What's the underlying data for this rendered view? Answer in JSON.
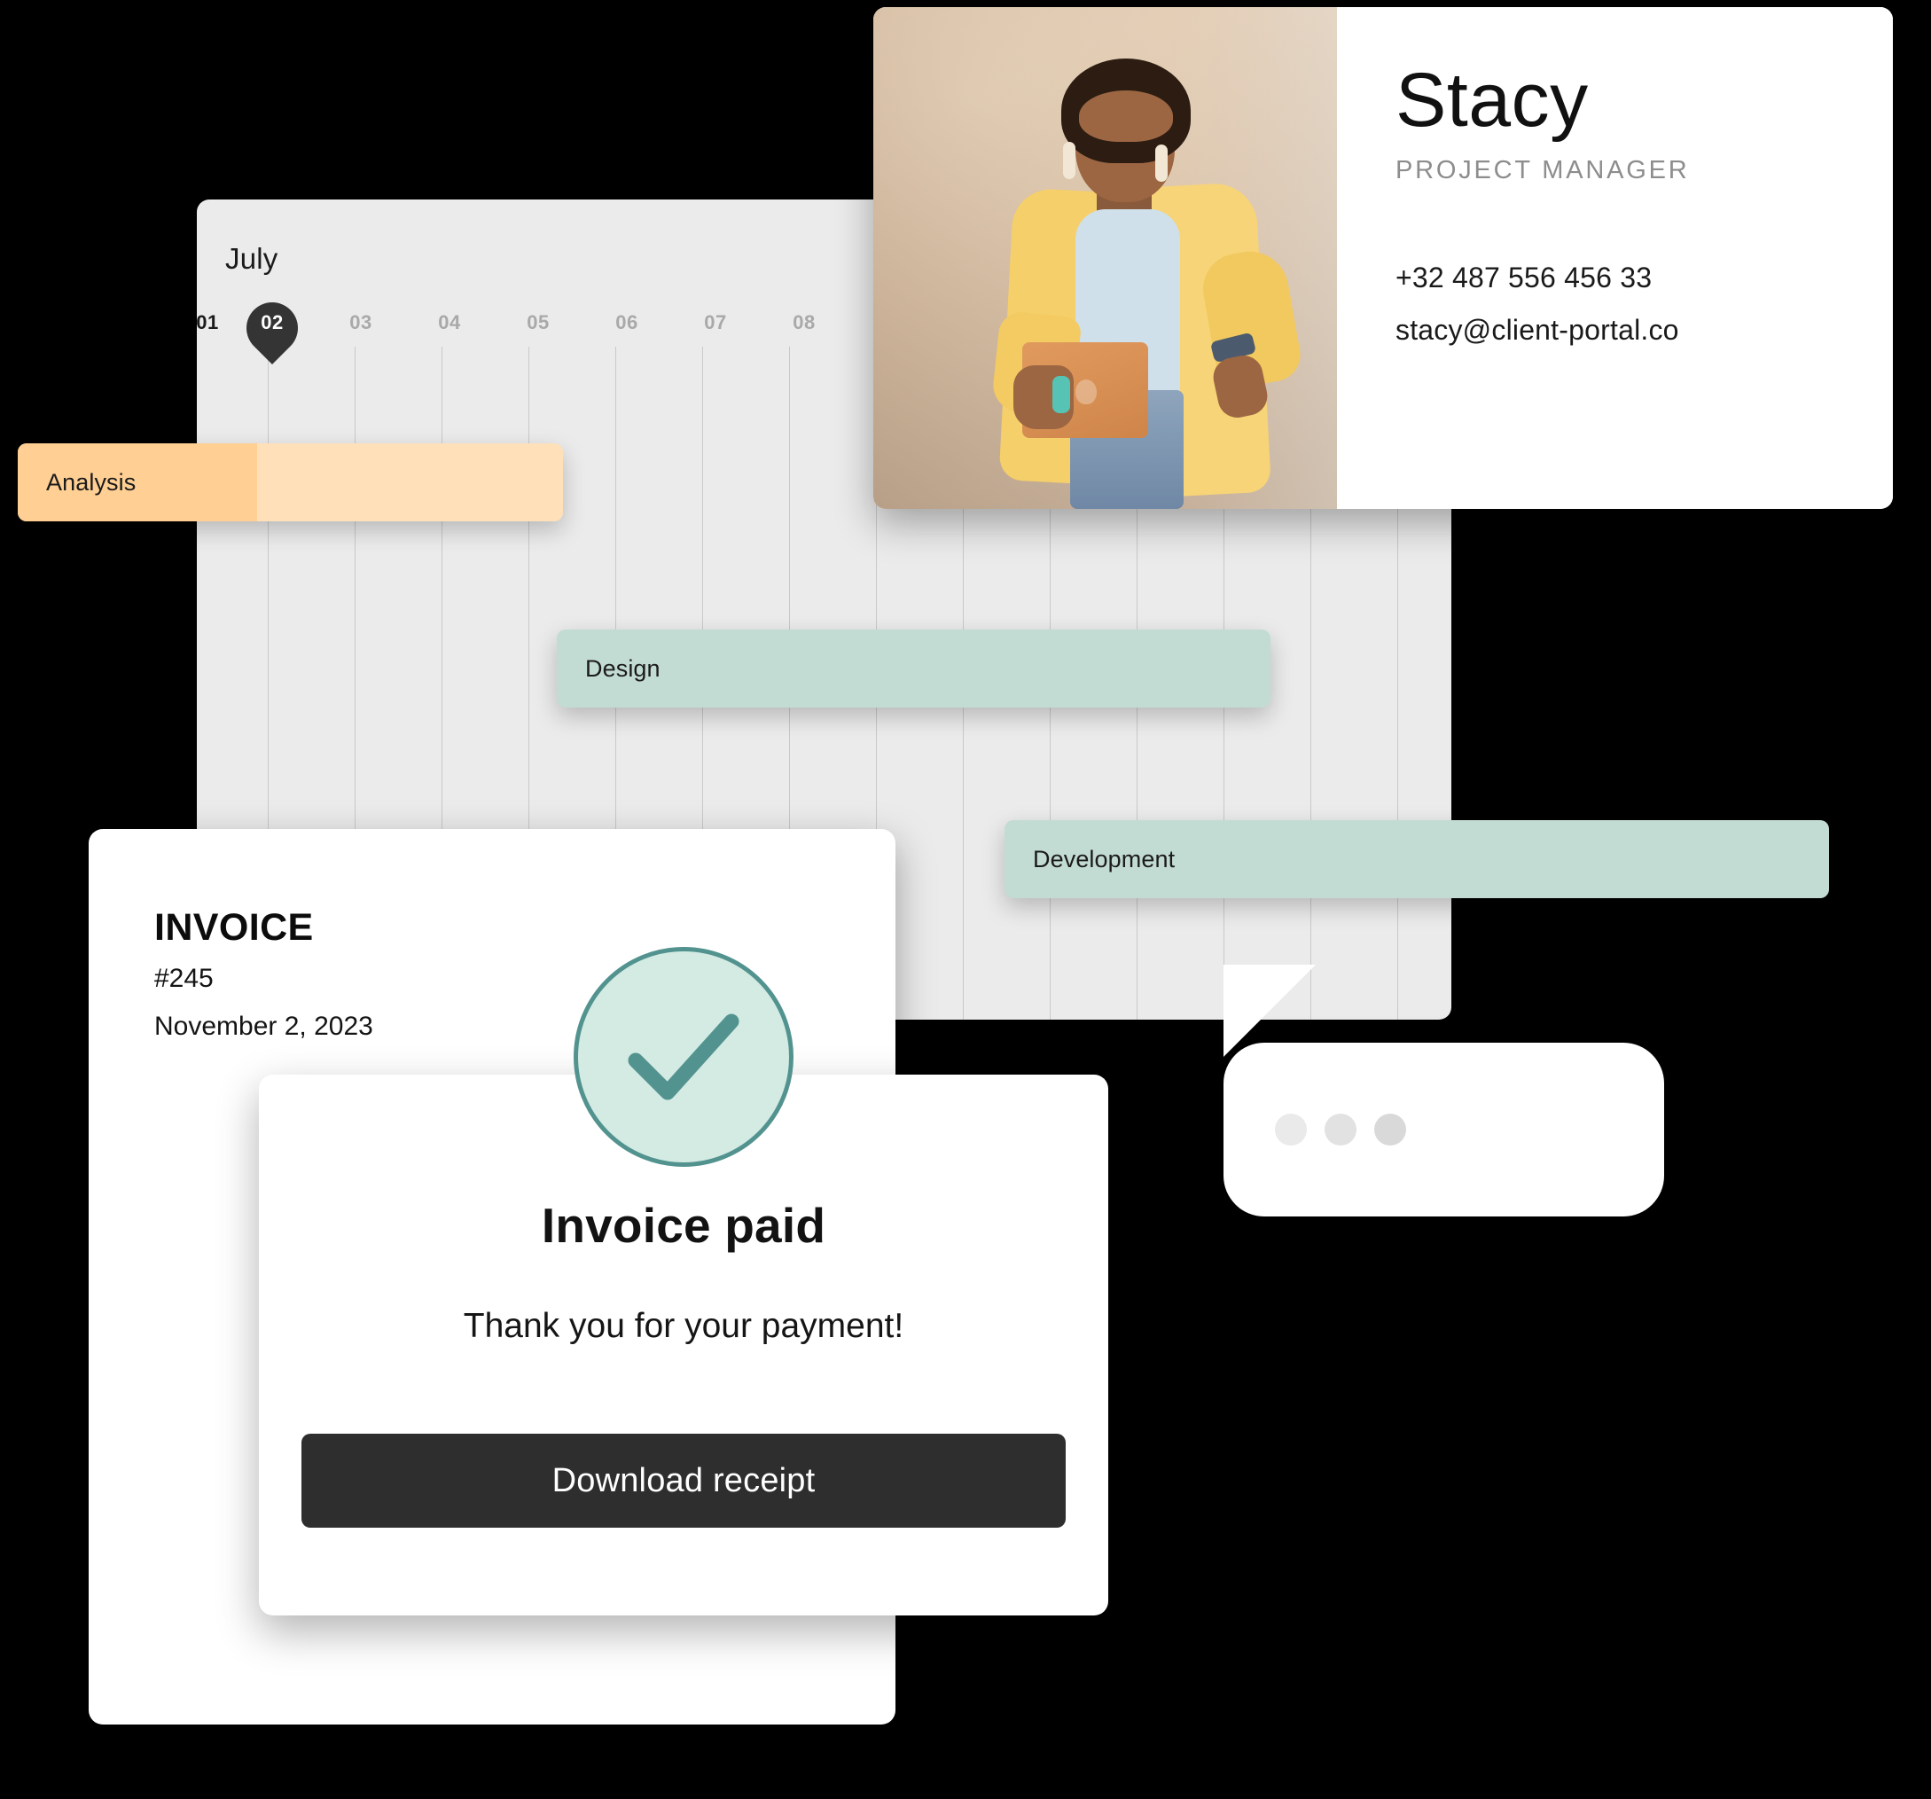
{
  "colors": {
    "accent_mint": "#c3dcd3",
    "accent_teal": "#53938f",
    "accent_mint_light": "#d3ebe3",
    "accent_orange": "#ffcf93",
    "accent_orange_light": "#ffe0b9",
    "dark": "#2e2e2e",
    "canvas": "#ebebeb"
  },
  "gantt": {
    "month": "July",
    "days": [
      {
        "label": "01",
        "state": "active"
      },
      {
        "label": "02",
        "state": "pin"
      },
      {
        "label": "03",
        "state": "normal"
      },
      {
        "label": "04",
        "state": "normal"
      },
      {
        "label": "05",
        "state": "normal"
      },
      {
        "label": "06",
        "state": "normal"
      },
      {
        "label": "07",
        "state": "normal"
      },
      {
        "label": "08",
        "state": "active"
      }
    ],
    "tasks": [
      {
        "label": "Analysis",
        "color": "#ffe0b9",
        "progress_color": "#ffcf93"
      },
      {
        "label": "Design",
        "color": "#c3dcd3"
      },
      {
        "label": "Development",
        "color": "#c3dcd3"
      }
    ]
  },
  "profile": {
    "name": "Stacy",
    "role": "PROJECT MANAGER",
    "phone": "+32 487 556 456 33",
    "email": "stacy@client-portal.co",
    "photo_alt": "portrait-photo"
  },
  "invoice": {
    "title": "INVOICE",
    "number": "#245",
    "date": "November 2, 2023"
  },
  "paid_modal": {
    "status_icon": "check-circle-icon",
    "title": "Invoice paid",
    "subtitle": "Thank you for your payment!",
    "button_label": "Download receipt"
  },
  "chat": {
    "typing_indicator": "typing-dots"
  }
}
